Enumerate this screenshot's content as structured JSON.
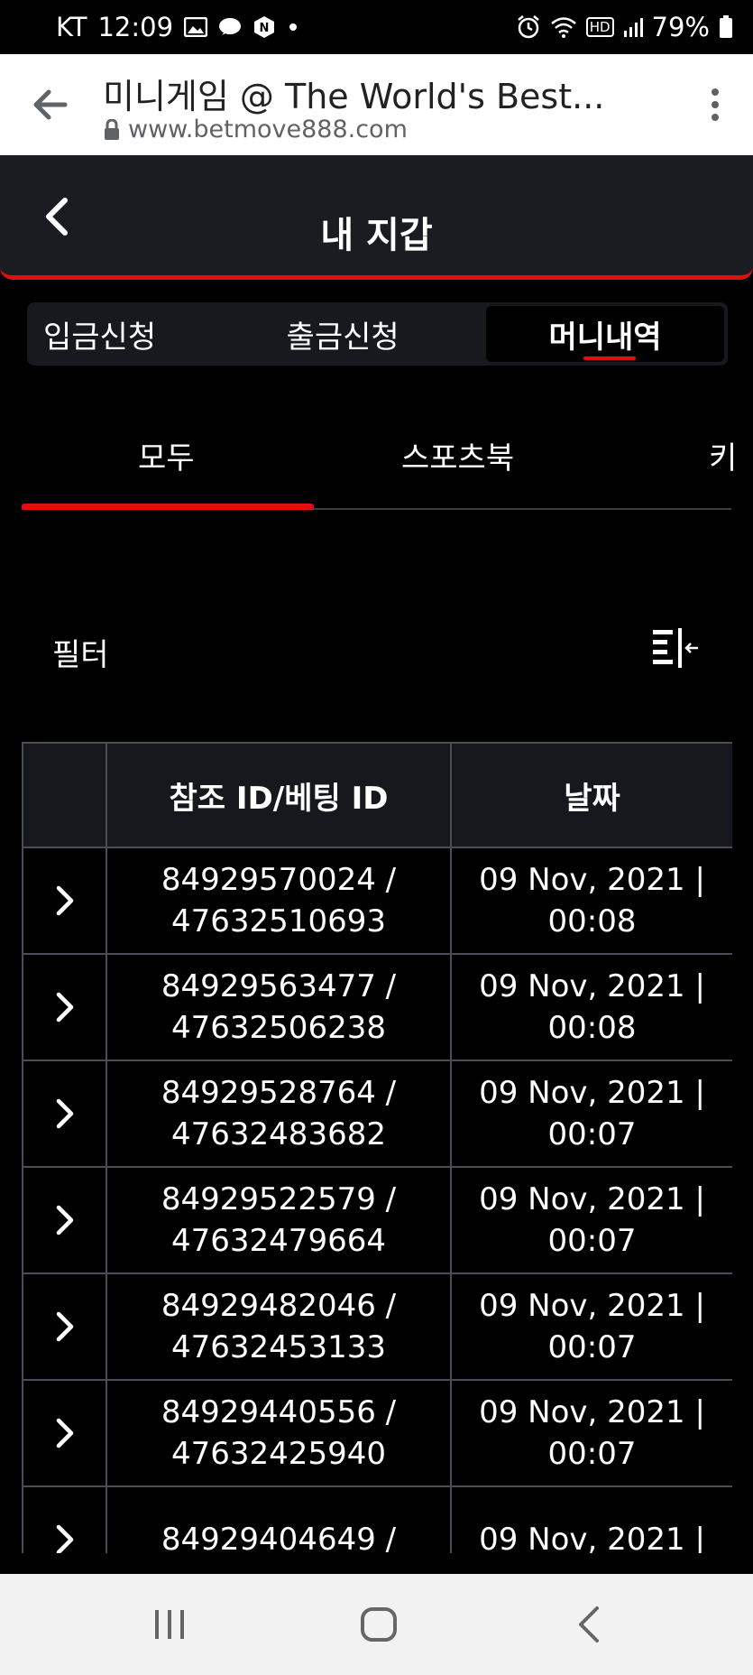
{
  "status_bar": {
    "carrier": "KT",
    "time": "12:09",
    "hd_label": "HD",
    "battery": "79%",
    "icons": [
      "gallery-icon",
      "chat-icon",
      "naver-icon",
      "dot-icon",
      "alarm-icon",
      "wifi-icon",
      "signal-icon",
      "battery-icon"
    ]
  },
  "browser": {
    "title": "미니게임 @ The World's Best...",
    "url": "www.betmove888.com"
  },
  "header": {
    "title": "내 지갑"
  },
  "wallet_tabs": [
    {
      "label": "입금신청"
    },
    {
      "label": "출금신청"
    },
    {
      "label": "머니내역"
    }
  ],
  "category_tabs": [
    {
      "label": "모두"
    },
    {
      "label": "스포츠북"
    },
    {
      "label": "키"
    }
  ],
  "filter": {
    "label": "필터"
  },
  "table": {
    "headers": [
      "",
      "참조 ID/베팅 ID",
      "날짜"
    ],
    "rows": [
      {
        "ref": "84929570024 /",
        "bet": "47632510693",
        "date": "09 Nov, 2021 |",
        "time": "00:08"
      },
      {
        "ref": "84929563477 /",
        "bet": "47632506238",
        "date": "09 Nov, 2021 |",
        "time": "00:08"
      },
      {
        "ref": "84929528764 /",
        "bet": "47632483682",
        "date": "09 Nov, 2021 |",
        "time": "00:07"
      },
      {
        "ref": "84929522579 /",
        "bet": "47632479664",
        "date": "09 Nov, 2021 |",
        "time": "00:07"
      },
      {
        "ref": "84929482046 /",
        "bet": "47632453133",
        "date": "09 Nov, 2021 |",
        "time": "00:07"
      },
      {
        "ref": "84929440556 /",
        "bet": "47632425940",
        "date": "09 Nov, 2021 |",
        "time": "00:07"
      },
      {
        "ref": "84929404649 /",
        "bet": "",
        "date": "09 Nov, 2021 |",
        "time": ""
      }
    ]
  },
  "colors": {
    "accent": "#e00e0e",
    "header_bg": "#1a1c22",
    "page_bg": "#000000"
  }
}
